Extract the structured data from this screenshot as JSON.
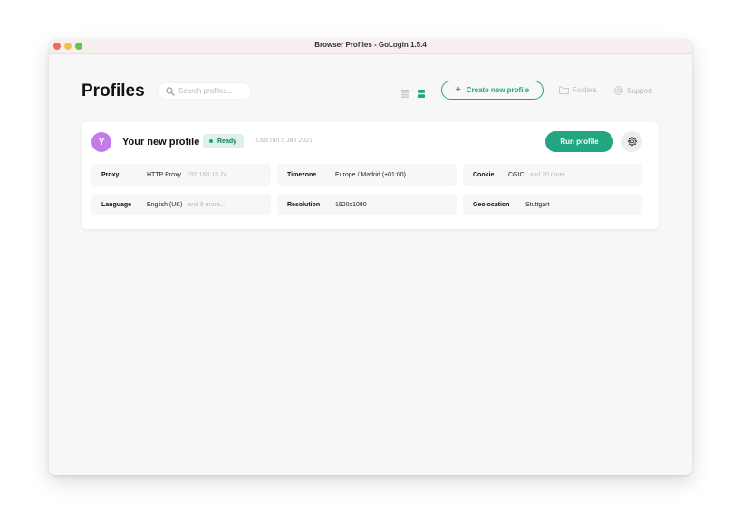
{
  "window": {
    "title": "Browser Profiles - GoLogin 1.5.4"
  },
  "header": {
    "title": "Profiles",
    "search_placeholder": "Search profiles...",
    "create_button": "Create new profile",
    "folders_label": "Folders",
    "support_label": "Support"
  },
  "profile": {
    "avatar_letter": "Y",
    "name": "Your new profile",
    "status": "Ready",
    "last_run": "Last run 5 Jan 2021",
    "run_button": "Run profile",
    "params": [
      {
        "label": "Proxy",
        "value": "HTTP Proxy",
        "extra": "192.168.15.24..."
      },
      {
        "label": "Timezone",
        "value": "Europe / Madrid (+01:00)",
        "extra": ""
      },
      {
        "label": "Cookie",
        "value": "CGIC",
        "extra": "and 20 more..."
      },
      {
        "label": "Language",
        "value": "English (UK)",
        "extra": "and 8 more..."
      },
      {
        "label": "Resolution",
        "value": "1920x1080",
        "extra": ""
      },
      {
        "label": "Geolocation",
        "value": "Stuttgart",
        "extra": ""
      }
    ]
  },
  "colors": {
    "accent": "#22a581",
    "status_bg": "#dcf1ea",
    "avatar": "#c47be8",
    "muted_text": "#b8b8be"
  },
  "icons": [
    "search-icon",
    "list-view-icon",
    "grid-view-icon",
    "plus-icon",
    "folder-icon",
    "support-icon",
    "gear-icon"
  ]
}
